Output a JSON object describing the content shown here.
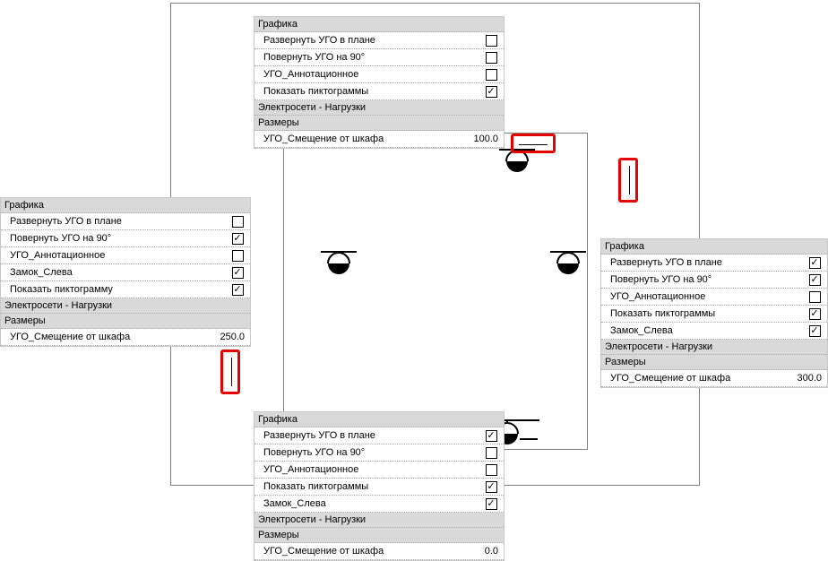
{
  "labels": {
    "grp_graphics": "Графика",
    "grp_elec": "Электросети - Нагрузки",
    "grp_dim": "Размеры",
    "row_flip": "Развернуть УГО в плане",
    "row_rot90": "Повернуть УГО на 90°",
    "row_anno": "УГО_Аннотационное",
    "row_lock_left": "Замок_Слева",
    "row_show_picts": "Показать пиктограммы",
    "row_show_pict": "Показать пиктограмму",
    "row_offset": "УГО_Смещение от шкафа"
  },
  "panels": {
    "top": {
      "flip": false,
      "rot90": false,
      "anno": false,
      "show_picts": true,
      "offset": "100.0"
    },
    "left": {
      "flip": false,
      "rot90": true,
      "anno": false,
      "lock_left": true,
      "show_pict": true,
      "offset": "250.0"
    },
    "bottom": {
      "flip": true,
      "rot90": false,
      "anno": false,
      "show_picts": true,
      "lock_left": true,
      "offset": "0.0"
    },
    "right": {
      "flip": true,
      "rot90": true,
      "anno": false,
      "show_picts": true,
      "lock_left": true,
      "offset": "300.0"
    }
  }
}
